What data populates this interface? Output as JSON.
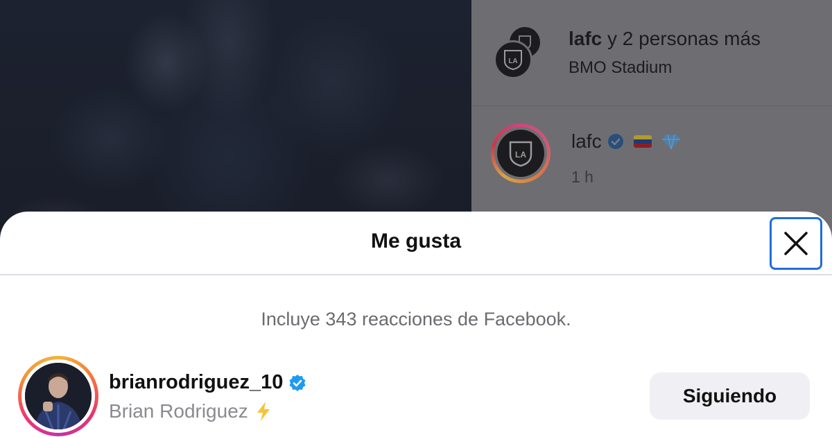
{
  "post": {
    "header_user": "lafc",
    "header_rest": "y 2 personas más",
    "location": "BMO Stadium",
    "author": "lafc",
    "time": "1 h"
  },
  "sheet": {
    "title": "Me gusta",
    "close_icon": "close-icon",
    "info": "Incluye 343 reacciones de Facebook."
  },
  "likes": [
    {
      "username": "brianrodriguez_10",
      "verified": true,
      "full_name": "Brian Rodriguez",
      "emoji_icon": "lightning-icon",
      "button_label": "Siguiendo"
    }
  ],
  "colors": {
    "verified": "#1d9bf0",
    "focus_outline": "#1f6ed6",
    "button_bg": "#efeff4"
  }
}
